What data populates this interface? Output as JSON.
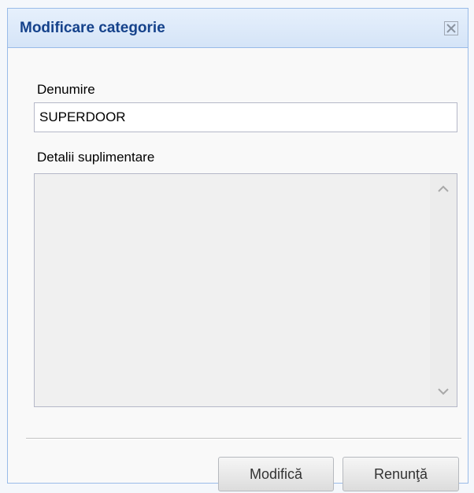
{
  "dialog": {
    "title": "Modificare categorie",
    "close_icon": "close-icon"
  },
  "form": {
    "denumire_label": "Denumire",
    "denumire_value": "SUPERDOOR",
    "detalii_label": "Detalii suplimentare",
    "detalii_value": ""
  },
  "buttons": {
    "modifica_label": "Modifică",
    "renunta_label": "Renunţă"
  },
  "icons": {
    "scroll_up": "chevron-up-icon",
    "scroll_down": "chevron-down-icon"
  },
  "colors": {
    "title_text": "#15428b",
    "header_border": "#99bbe8",
    "body_background": "#f9f9f9"
  }
}
